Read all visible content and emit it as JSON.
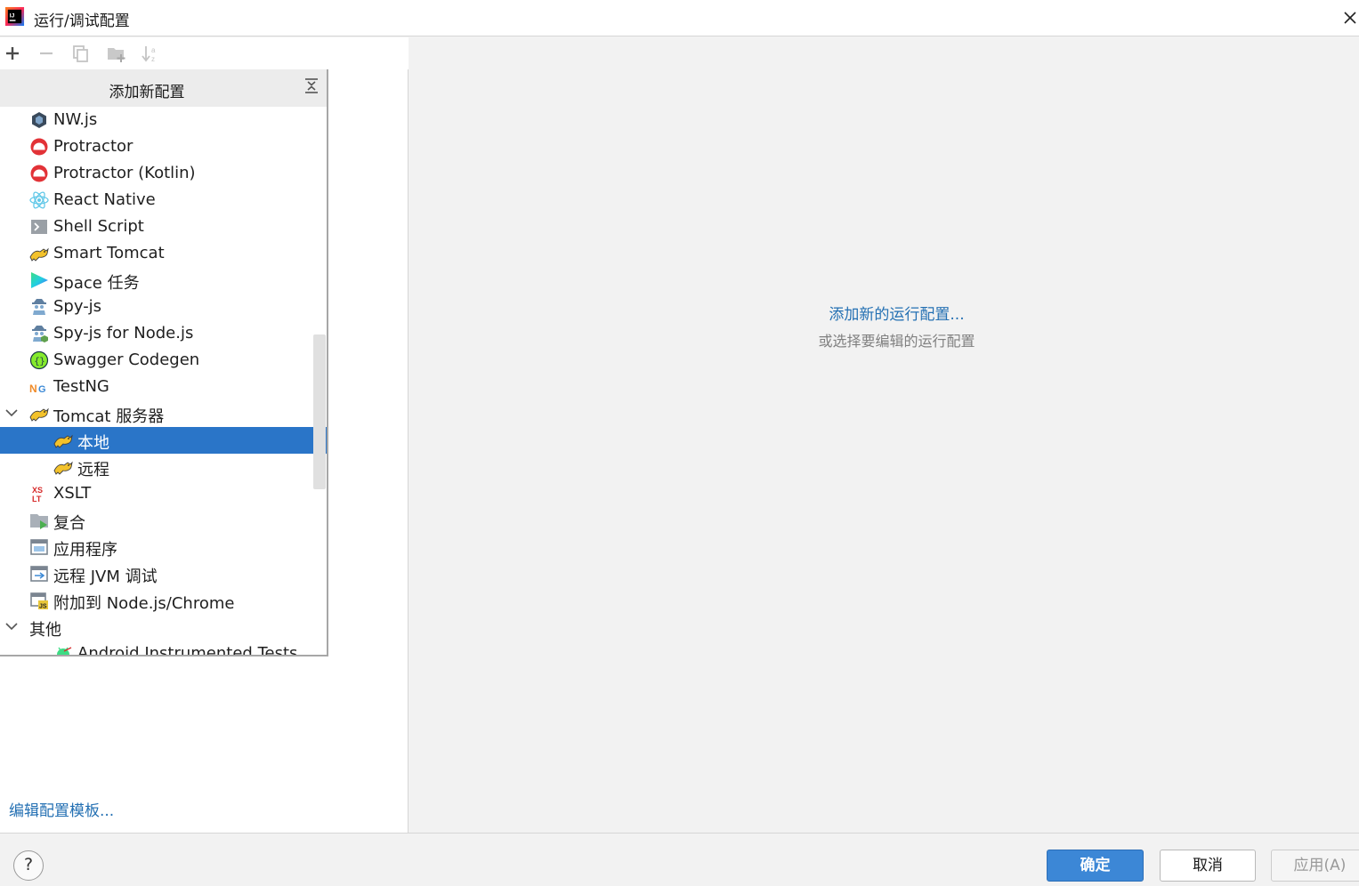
{
  "window": {
    "title": "运行/调试配置"
  },
  "toolbar": {
    "buttons": [
      {
        "name": "add",
        "icon": "plus-icon",
        "enabled": true
      },
      {
        "name": "remove",
        "icon": "minus-icon",
        "enabled": false
      },
      {
        "name": "copy",
        "icon": "copy-icon",
        "enabled": false
      },
      {
        "name": "new-folder",
        "icon": "folder-add-icon",
        "enabled": false
      },
      {
        "name": "sort",
        "icon": "sort-icon",
        "enabled": false
      }
    ]
  },
  "popup": {
    "title": "添加新配置",
    "items": [
      {
        "label": "NW.js",
        "icon": "nwjs-icon",
        "level": 0
      },
      {
        "label": "Protractor",
        "icon": "protractor-icon",
        "level": 0
      },
      {
        "label": "Protractor (Kotlin)",
        "icon": "protractor-icon",
        "level": 0
      },
      {
        "label": "React Native",
        "icon": "react-icon",
        "level": 0
      },
      {
        "label": "Shell Script",
        "icon": "shell-script-icon",
        "level": 0
      },
      {
        "label": "Smart Tomcat",
        "icon": "tomcat-icon",
        "level": 0
      },
      {
        "label": "Space 任务",
        "icon": "space-icon",
        "level": 0
      },
      {
        "label": "Spy-js",
        "icon": "spy-js-icon",
        "level": 0
      },
      {
        "label": "Spy-js for Node.js",
        "icon": "spy-js-node-icon",
        "level": 0
      },
      {
        "label": "Swagger Codegen",
        "icon": "swagger-icon",
        "level": 0
      },
      {
        "label": "TestNG",
        "icon": "testng-icon",
        "level": 0
      },
      {
        "label": "Tomcat 服务器",
        "icon": "tomcat-icon",
        "level": 0,
        "expanded": true
      },
      {
        "label": "本地",
        "icon": "tomcat-icon",
        "level": 1,
        "selected": true
      },
      {
        "label": "远程",
        "icon": "tomcat-icon",
        "level": 1
      },
      {
        "label": "XSLT",
        "icon": "xslt-icon",
        "level": 0
      },
      {
        "label": "复合",
        "icon": "compound-icon",
        "level": 0
      },
      {
        "label": "应用程序",
        "icon": "application-icon",
        "level": 0
      },
      {
        "label": "远程 JVM 调试",
        "icon": "remote-debug-icon",
        "level": 0
      },
      {
        "label": "附加到 Node.js/Chrome",
        "icon": "attach-node-icon",
        "level": 0
      },
      {
        "label": "其他",
        "icon": "",
        "level": -1,
        "expanded": true
      },
      {
        "label": "Android Instrumented Tests",
        "icon": "android-icon",
        "level": 1
      }
    ]
  },
  "left_footer": {
    "edit_templates": "编辑配置模板..."
  },
  "main": {
    "add_new_link": "添加新的运行配置...",
    "hint": "或选择要编辑的运行配置"
  },
  "footer": {
    "help": "?",
    "ok": "确定",
    "cancel": "取消",
    "apply": "应用(A)"
  },
  "colors": {
    "accent": "#2a75c8",
    "link": "#2470b3",
    "ok_button": "#3c87d6"
  }
}
